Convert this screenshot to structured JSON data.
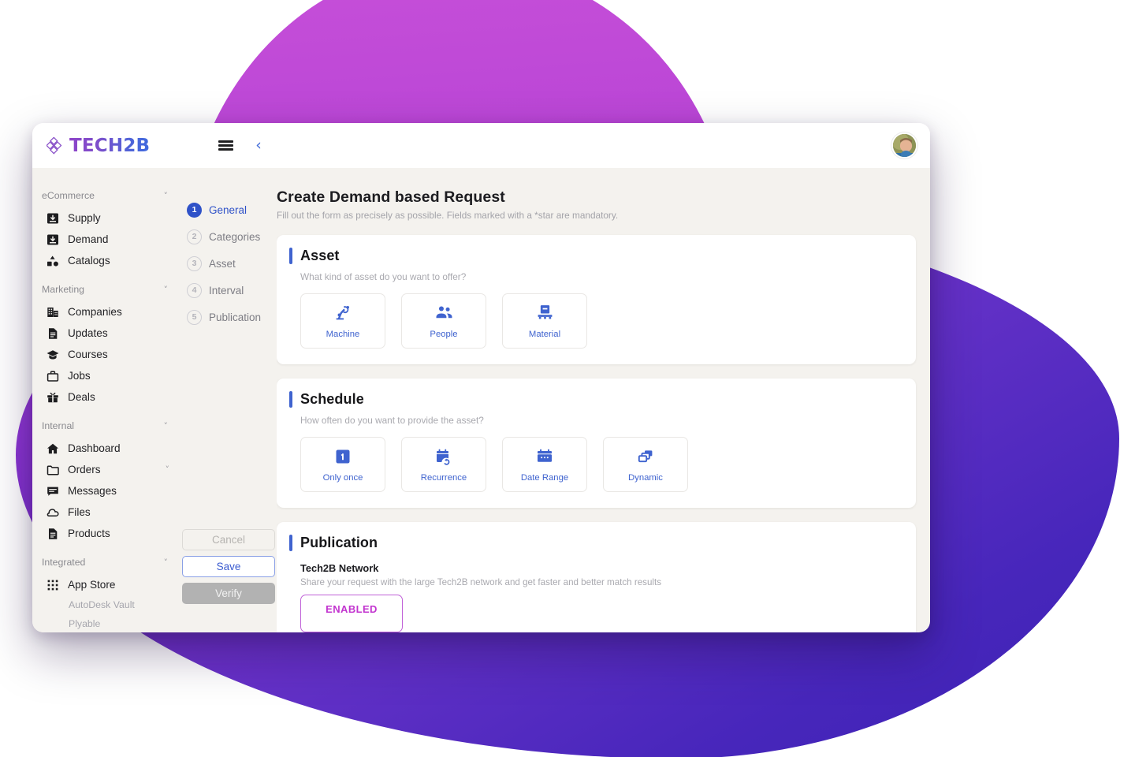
{
  "brand": {
    "name": "TECH2B",
    "logo_mark": "diamond-cluster-icon",
    "gradient_from": "#8e44c9",
    "gradient_to": "#3f6ade"
  },
  "topbar": {
    "menu_icon": "hamburger-icon",
    "back_icon": "chevron-left-icon",
    "avatar": "user-avatar"
  },
  "sidebar": {
    "groups": [
      {
        "label": "eCommerce",
        "chevron": "chevron-down-icon",
        "items": [
          {
            "label": "Supply",
            "icon": "inbox-down-icon"
          },
          {
            "label": "Demand",
            "icon": "inbox-down-icon"
          },
          {
            "label": "Catalogs",
            "icon": "category-shapes-icon"
          }
        ]
      },
      {
        "label": "Marketing",
        "chevron": "chevron-down-icon",
        "items": [
          {
            "label": "Companies",
            "icon": "building-icon"
          },
          {
            "label": "Updates",
            "icon": "document-icon"
          },
          {
            "label": "Courses",
            "icon": "graduation-cap-icon"
          },
          {
            "label": "Jobs",
            "icon": "briefcase-icon"
          },
          {
            "label": "Deals",
            "icon": "gift-icon"
          }
        ]
      },
      {
        "label": "Internal",
        "chevron": "chevron-down-icon",
        "items": [
          {
            "label": "Dashboard",
            "icon": "home-icon"
          },
          {
            "label": "Orders",
            "icon": "folder-icon",
            "chevron": "chevron-down-icon"
          },
          {
            "label": "Messages",
            "icon": "chat-icon"
          },
          {
            "label": "Files",
            "icon": "cloud-icon"
          },
          {
            "label": "Products",
            "icon": "document-icon"
          }
        ]
      },
      {
        "label": "Integrated",
        "chevron": "chevron-down-icon",
        "items": [
          {
            "label": "App Store",
            "icon": "grid-apps-icon"
          }
        ],
        "subitems": [
          "AutoDesk Vault",
          "Plyable"
        ]
      }
    ]
  },
  "stepper": {
    "steps": [
      {
        "num": "1",
        "label": "General",
        "state": "active"
      },
      {
        "num": "2",
        "label": "Categories",
        "state": "idle"
      },
      {
        "num": "3",
        "label": "Asset",
        "state": "idle"
      },
      {
        "num": "4",
        "label": "Interval",
        "state": "idle"
      },
      {
        "num": "5",
        "label": "Publication",
        "state": "idle"
      }
    ]
  },
  "actions": {
    "cancel_label": "Cancel",
    "save_label": "Save",
    "verify_label": "Verify"
  },
  "page": {
    "title": "Create Demand based Request",
    "subtitle": "Fill out the form as precisely as possible. Fields marked with a *star are mandatory."
  },
  "asset_section": {
    "title": "Asset",
    "question": "What kind of asset do you want to offer?",
    "options": [
      {
        "label": "Machine",
        "icon": "robot-arm-icon"
      },
      {
        "label": "People",
        "icon": "people-group-icon"
      },
      {
        "label": "Material",
        "icon": "pallet-box-icon"
      }
    ]
  },
  "schedule_section": {
    "title": "Schedule",
    "question": "How often do you want to provide the asset?",
    "options": [
      {
        "label": "Only once",
        "icon": "number-one-box-icon"
      },
      {
        "label": "Recurrence",
        "icon": "calendar-repeat-icon"
      },
      {
        "label": "Date Range",
        "icon": "calendar-range-icon"
      },
      {
        "label": "Dynamic",
        "icon": "layers-stack-icon"
      }
    ]
  },
  "publication_section": {
    "title": "Publication",
    "network_name": "Tech2B Network",
    "network_desc": "Share your request with the large Tech2B network and get faster and better match results",
    "toggle_state": "ENABLED",
    "toggle_color": "#c234cf"
  },
  "colors": {
    "accent_blue": "#3f63cf",
    "sidebar_bg": "#f4f2ee",
    "card_bg": "#ffffff"
  }
}
